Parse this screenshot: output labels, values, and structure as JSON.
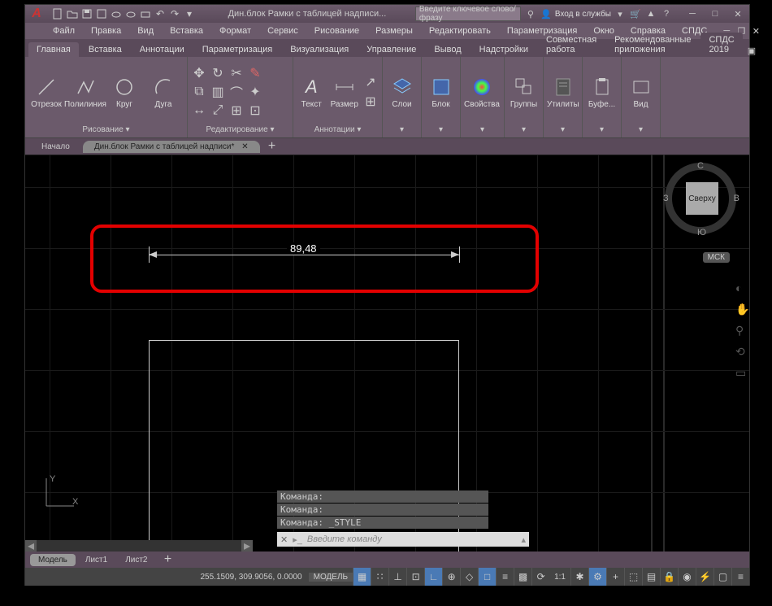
{
  "title": "Дин.блок Рамки с таблицей надписи...",
  "search_placeholder": "Введите ключевое слово/фразу",
  "sign_in": "Вход в службы",
  "menu": [
    "Файл",
    "Правка",
    "Вид",
    "Вставка",
    "Формат",
    "Сервис",
    "Рисование",
    "Размеры",
    "Редактировать",
    "Параметризация",
    "Окно",
    "Справка",
    "СПДС"
  ],
  "tabs": [
    "Главная",
    "Вставка",
    "Аннотации",
    "Параметризация",
    "Визуализация",
    "Управление",
    "Вывод",
    "Надстройки",
    "Совместная работа",
    "Рекомендованные приложения"
  ],
  "special_tab": "СПДС 2019",
  "panels": {
    "draw": {
      "title": "Рисование ▾",
      "btns": [
        "Отрезок",
        "Полилиния",
        "Круг",
        "Дуга"
      ]
    },
    "edit": {
      "title": "Редактирование ▾"
    },
    "annot": {
      "title": "Аннотации ▾",
      "btns": [
        "Текст",
        "Размер"
      ]
    },
    "layers": {
      "title": "Слои"
    },
    "block": {
      "title": "Блок"
    },
    "props": {
      "title": "Свойства"
    },
    "groups": {
      "title": "Группы"
    },
    "util": {
      "title": "Утилиты"
    },
    "clip": {
      "title": "Буфе..."
    },
    "view": {
      "title": "Вид"
    }
  },
  "filetabs": [
    {
      "label": "Начало",
      "active": false
    },
    {
      "label": "Дин.блок Рамки с таблицей надписи*",
      "active": true
    }
  ],
  "dimension_text": "89,48",
  "viewcube": {
    "face": "Сверху",
    "n": "С",
    "s": "Ю",
    "e": "В",
    "w": "З",
    "wcs": "МСК"
  },
  "cmd_history": [
    "Команда:",
    "Команда:",
    "Команда: _STYLE"
  ],
  "cmd_placeholder": "Введите команду",
  "model_tabs": [
    "Модель",
    "Лист1",
    "Лист2"
  ],
  "status": {
    "coords": "255.1509, 309.9056, 0.0000",
    "model": "МОДЕЛЬ",
    "scale": "1:1"
  }
}
